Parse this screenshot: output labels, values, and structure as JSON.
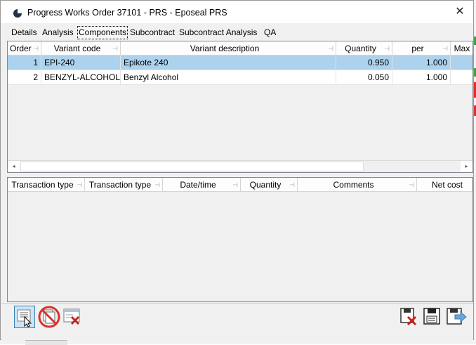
{
  "window": {
    "title": "Progress Works Order 37101 - PRS - Eposeal PRS",
    "close_glyph": "✕"
  },
  "menu": [
    {
      "label": "Details"
    },
    {
      "label": "Analysis"
    },
    {
      "label": "Components",
      "active": true
    },
    {
      "label": "Subcontract"
    },
    {
      "label": "Subcontract Analysis"
    },
    {
      "label": "QA"
    }
  ],
  "components_grid": {
    "headers": [
      "Order",
      "Variant code",
      "Variant description",
      "Quantity",
      "per",
      "Max"
    ],
    "rows": [
      {
        "order": "1",
        "code": "EPI-240",
        "description": "Epikote 240",
        "quantity": "0.950",
        "per": "1.000",
        "max": "",
        "selected": true
      },
      {
        "order": "2",
        "code": "BENZYL-ALCOHOL",
        "description": "Benzyl Alcohol",
        "quantity": "0.050",
        "per": "1.000",
        "max": "",
        "selected": false
      }
    ]
  },
  "transactions_grid": {
    "headers": [
      "Transaction type",
      "Transaction type",
      "Date/time",
      "Quantity",
      "Comments",
      "Net cost"
    ]
  },
  "icons": {
    "app": "pie-chart-icon",
    "pin": "pin-icon",
    "scroll_left": "scroll-left-icon",
    "scroll_right": "scroll-right-icon",
    "edit": "edit-list-icon",
    "no_copy": "prohibited-copy-icon",
    "delete_row": "delete-row-icon",
    "discard": "discard-icon",
    "save": "save-icon",
    "save_close": "save-and-close-icon"
  },
  "colors": {
    "selected_row": "#add2ee",
    "pressed_button": "#cce4f7",
    "prohibited": "#d9322b"
  }
}
